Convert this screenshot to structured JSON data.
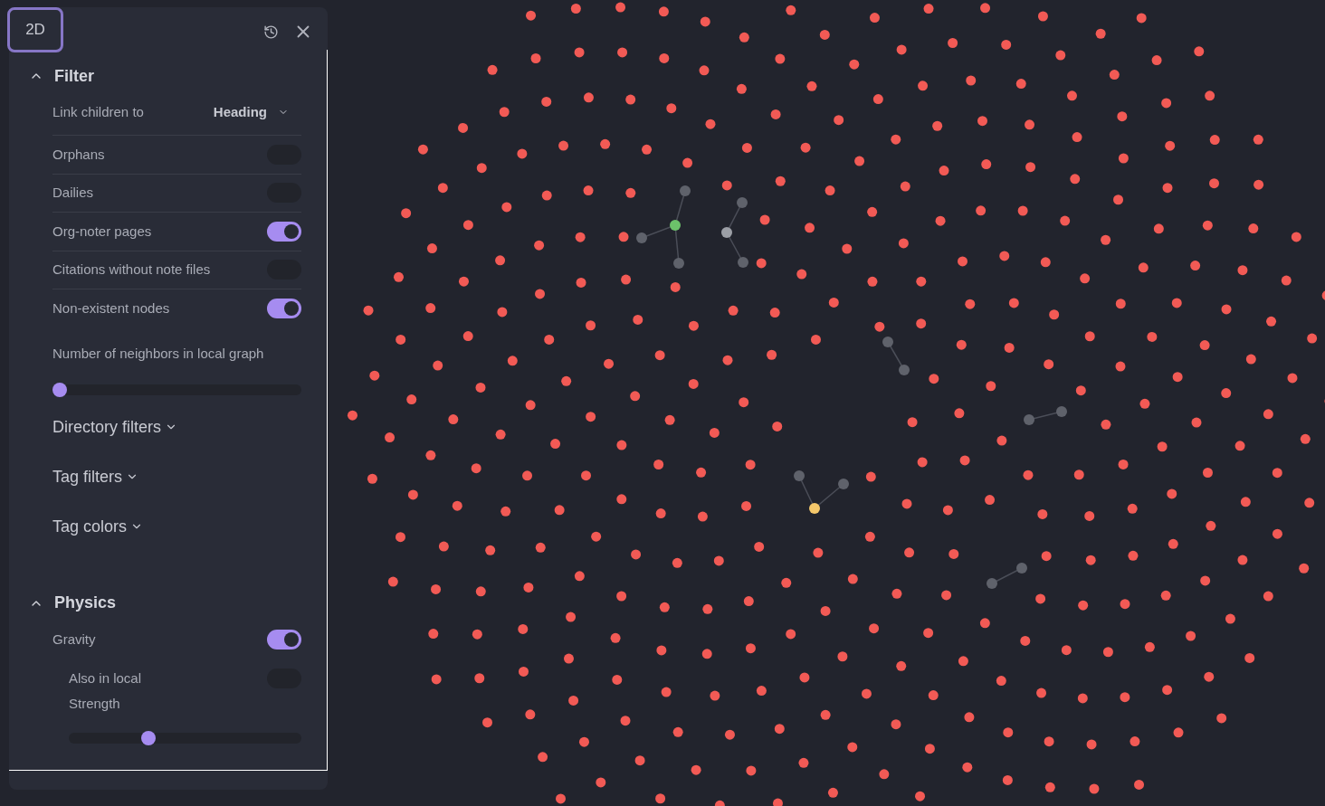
{
  "mode_button": "2D",
  "sections": [
    {
      "title": "Filter",
      "expanded": true,
      "items": [
        {
          "kind": "select",
          "label": "Link children to",
          "value": "Heading"
        },
        {
          "kind": "toggle",
          "label": "Orphans",
          "on": false
        },
        {
          "kind": "toggle",
          "label": "Dailies",
          "on": false
        },
        {
          "kind": "toggle",
          "label": "Org-noter pages",
          "on": true
        },
        {
          "kind": "toggle",
          "label": "Citations without note files",
          "on": false
        },
        {
          "kind": "toggle",
          "label": "Non-existent nodes",
          "on": true
        },
        {
          "kind": "slider",
          "label": "Number of neighbors in local graph",
          "level": 0
        },
        {
          "kind": "collapsible",
          "label": "Directory filters",
          "expanded": false
        },
        {
          "kind": "collapsible",
          "label": "Tag filters",
          "expanded": false
        },
        {
          "kind": "collapsible",
          "label": "Tag colors",
          "expanded": false
        }
      ]
    },
    {
      "title": "Physics",
      "expanded": true,
      "items": [
        {
          "kind": "toggle",
          "label": "Gravity",
          "on": true
        },
        {
          "kind": "subtoggle",
          "label": "Also in local",
          "on": false
        },
        {
          "kind": "subslider",
          "label": "Strength",
          "level": 0.33
        }
      ]
    }
  ]
}
